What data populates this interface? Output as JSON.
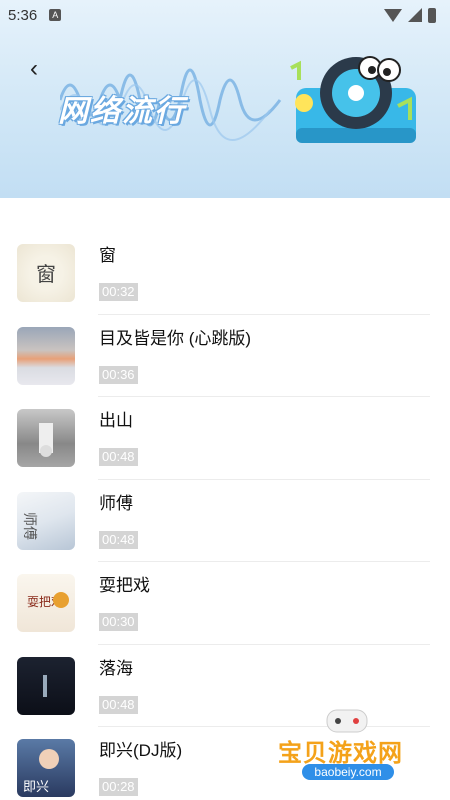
{
  "status_bar": {
    "time": "5:36",
    "a_badge": "A"
  },
  "header": {
    "title": "网络流行",
    "back_icon": "‹"
  },
  "songs": [
    {
      "title": "窗",
      "duration": "00:32"
    },
    {
      "title": "目及皆是你 (心跳版)",
      "duration": "00:36"
    },
    {
      "title": "出山",
      "duration": "00:48"
    },
    {
      "title": "师傅",
      "duration": "00:48"
    },
    {
      "title": "耍把戏",
      "duration": "00:30"
    },
    {
      "title": "落海",
      "duration": "00:48"
    },
    {
      "title": "即兴(DJ版)",
      "duration": "00:28"
    }
  ],
  "cover_text": {
    "c0": "窗",
    "c3": "师傅",
    "c4": "耍把戏",
    "c6": "即兴"
  },
  "watermark": {
    "brand": "宝贝游戏网",
    "url": "baobeiy.com"
  },
  "colors": {
    "banner_bg": "#cfe6f6",
    "accent": "#6aa8e0",
    "watermark_orange": "#f4a21a"
  }
}
